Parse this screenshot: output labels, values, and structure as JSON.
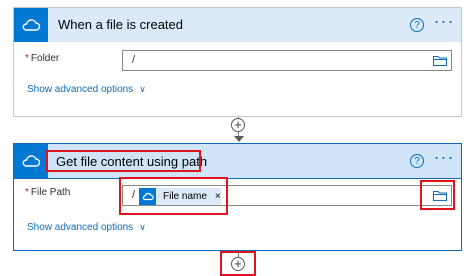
{
  "trigger": {
    "title": "When a file is created",
    "help_glyph": "?",
    "more_glyph": "···",
    "field": {
      "label": "Folder",
      "required_mark": "*",
      "value": "/"
    },
    "advanced_label": "Show advanced options",
    "advanced_chevron": "∨"
  },
  "action": {
    "title": "Get file content using path",
    "help_glyph": "?",
    "more_glyph": "···",
    "field": {
      "label": "File Path",
      "required_mark": "*",
      "prefix": "/",
      "token_label": "File name",
      "token_remove": "×"
    },
    "advanced_label": "Show advanced options",
    "advanced_chevron": "∨"
  },
  "connectors": {
    "plus_glyph": "+"
  },
  "icons": {
    "header": "onedrive-cloud-icon",
    "folder": "folder-picker-icon",
    "help": "help-icon",
    "more": "more-options-icon"
  },
  "colors": {
    "accent": "#0078d4",
    "header_bg": "#dce9f8",
    "highlight": "#e0141e",
    "link": "#0f6cbd"
  }
}
